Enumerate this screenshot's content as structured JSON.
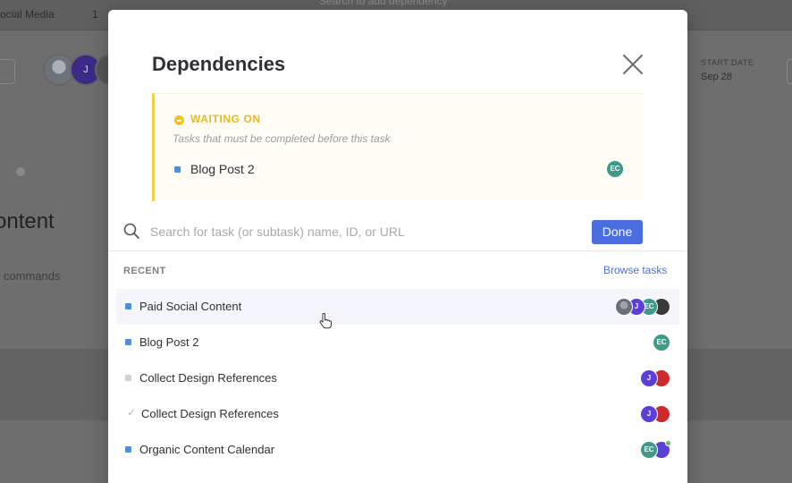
{
  "background": {
    "breadcrumb": "ocial Media",
    "count": "1",
    "search_hint": "Search to add dependency",
    "start_date_label": "START DATE",
    "start_date_value": "Sep 28",
    "title": "ontent",
    "commands_hint": "r commands",
    "avatar_initial": "J"
  },
  "modal": {
    "title": "Dependencies",
    "waiting_on": {
      "title": "WAITING ON",
      "subtitle": "Tasks that must be completed before this task",
      "task": "Blog Post 2",
      "assignee": "EC"
    },
    "search": {
      "placeholder": "Search for task (or subtask) name, ID, or URL"
    },
    "done_label": "Done",
    "recent_label": "RECENT",
    "browse_label": "Browse tasks",
    "rows": [
      {
        "label": "Paid Social Content",
        "marker": "blue",
        "avatars": [
          "photo",
          "J",
          "EC",
          "dark"
        ]
      },
      {
        "label": "Blog Post 2",
        "marker": "blue",
        "avatars": [
          "EC"
        ]
      },
      {
        "label": "Collect Design References",
        "marker": "grey",
        "avatars": [
          "J",
          "red"
        ]
      },
      {
        "label": "Collect Design References",
        "marker": "check",
        "avatars": [
          "J",
          "red"
        ]
      },
      {
        "label": "Organic Content Calendar",
        "marker": "blue",
        "avatars": [
          "EC",
          "J"
        ]
      }
    ]
  },
  "colors": {
    "accent": "#4a6ee0",
    "waiting": "#f5cd47",
    "task_blue": "#4a90e2"
  }
}
